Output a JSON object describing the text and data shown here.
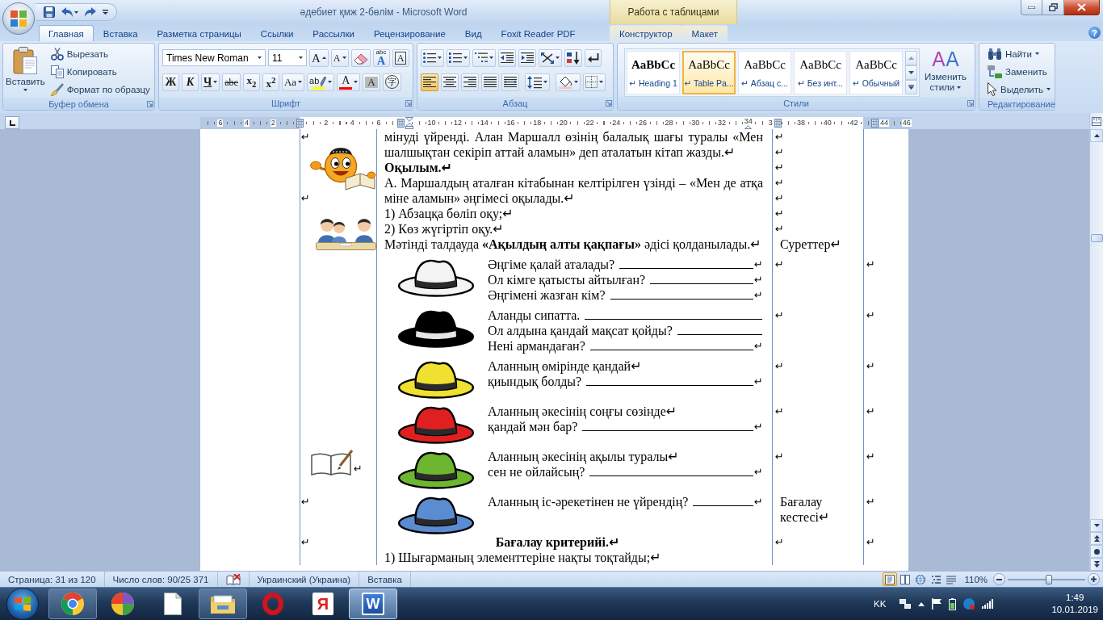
{
  "window": {
    "title": "әдебиет қмж 2-бөлім - Microsoft Word",
    "context_title": "Работа с таблицами"
  },
  "tabs": [
    {
      "label": "Главная",
      "selected": true,
      "contextual": false
    },
    {
      "label": "Вставка",
      "selected": false,
      "contextual": false
    },
    {
      "label": "Разметка страницы",
      "selected": false,
      "contextual": false
    },
    {
      "label": "Ссылки",
      "selected": false,
      "contextual": false
    },
    {
      "label": "Рассылки",
      "selected": false,
      "contextual": false
    },
    {
      "label": "Рецензирование",
      "selected": false,
      "contextual": false
    },
    {
      "label": "Вид",
      "selected": false,
      "contextual": false
    },
    {
      "label": "Foxit Reader PDF",
      "selected": false,
      "contextual": false
    },
    {
      "label": "Конструктор",
      "selected": false,
      "contextual": true
    },
    {
      "label": "Макет",
      "selected": false,
      "contextual": true
    }
  ],
  "help": "?",
  "ribbon": {
    "clipboard": {
      "title": "Буфер обмена",
      "paste": "Вставить",
      "actions": [
        "Вырезать",
        "Копировать",
        "Формат по образцу"
      ]
    },
    "font": {
      "title": "Шрифт",
      "font_name": "Times New Roman",
      "font_size": "11",
      "tools": [
        {
          "kind": "grow",
          "glyph": "A"
        },
        {
          "kind": "shrink",
          "glyph": "A"
        },
        {
          "kind": "clear"
        },
        {
          "kind": "effects",
          "glyph": "A",
          "caption": "abc"
        },
        {
          "kind": "border",
          "glyph": "A"
        }
      ],
      "format": [
        {
          "kind": "bold",
          "glyph": "Ж"
        },
        {
          "kind": "italic",
          "glyph": "К"
        },
        {
          "kind": "underline",
          "glyph": "Ч"
        },
        {
          "kind": "strike",
          "glyph": "abc"
        },
        {
          "kind": "sub",
          "glyph": "x$_{2}$"
        },
        {
          "kind": "sup",
          "glyph": "x$^{2}$"
        },
        {
          "kind": "case",
          "glyph": "Aa"
        },
        {
          "kind": "highlight",
          "glyph": "ab",
          "color": "#ffff00"
        },
        {
          "kind": "color",
          "glyph": "A",
          "color": "#ff0000"
        },
        {
          "kind": "shade",
          "glyph": "A"
        },
        {
          "kind": "enclose",
          "glyph": "字"
        }
      ]
    },
    "paragraph": {
      "title": "Абзац",
      "alignment": [
        {
          "kind": "left",
          "selected": true
        },
        {
          "kind": "center",
          "selected": false
        },
        {
          "kind": "right",
          "selected": false
        },
        {
          "kind": "justify",
          "selected": false
        },
        {
          "kind": "distribute",
          "selected": false
        }
      ]
    },
    "styles": {
      "title": "Стили",
      "items": [
        {
          "kind": "heading",
          "sample": "AaBbCc",
          "name": "↵ Heading 1",
          "selected": false
        },
        {
          "kind": "normal",
          "sample": "AaBbCc",
          "name": "↵ Table Pa...",
          "selected": true
        },
        {
          "kind": "normal",
          "sample": "AaBbCc",
          "name": "↵ Абзац с...",
          "selected": false
        },
        {
          "kind": "normal",
          "sample": "AaBbCc",
          "name": "↵ Без инт...",
          "selected": false
        },
        {
          "kind": "normal",
          "sample": "AaBbCc",
          "name": "↵ Обычный",
          "selected": false
        }
      ],
      "change": {
        "glyph": "AA",
        "label": "Изменить стили"
      }
    },
    "editing": {
      "title": "Редактирование",
      "actions": [
        {
          "label": "Найти",
          "menu": true
        },
        {
          "label": "Заменить",
          "menu": false
        },
        {
          "label": "Выделить",
          "menu": true
        }
      ]
    }
  },
  "ruler": {
    "numbers": [
      "6",
      "4",
      "2",
      "2",
      "4",
      "6",
      "10",
      "12",
      "14",
      "16",
      "18",
      "20",
      "22",
      "24",
      "26",
      "28",
      "30",
      "32",
      "34",
      "3",
      "38",
      "40",
      "42",
      "44",
      "46"
    ]
  },
  "document": {
    "rows": [
      {
        "kind": "text",
        "left": [
          {
            "kind": "mark",
            "text": "↵"
          },
          {
            "kind": "smiley"
          },
          {
            "kind": "mark",
            "text": "↵"
          },
          {
            "kind": "pupils"
          }
        ],
        "paragraphs": [
          {
            "kind": "body",
            "text": "мінуді үйренді. Алан Маршалл өзінің балалық шағы туралы «Мен шалшықтан секіріп аттай аламын» деп аталатын кітап жазды.↵"
          },
          {
            "kind": "heading",
            "text": "Оқылым.↵"
          },
          {
            "kind": "body",
            "text": "А. Маршалдың аталған кітабынан келтірілген үзінді – «Мен де атқа міне аламын» әңгімесі оқылады.↵"
          },
          {
            "kind": "body",
            "text": "1) Абзацқа бөліп оқу;↵"
          },
          {
            "kind": "body",
            "text": "2) Көз жүгіртіп оқу.↵"
          },
          {
            "kind": "body",
            "text": "Мәтінді талдауда **«Ақылдың алты қақпағы»** әдісі қолданылады.↵"
          }
        ],
        "notes": [
          {
            "kind": "mark",
            "text": "↵"
          },
          {
            "kind": "mark",
            "text": "↵"
          },
          {
            "kind": "mark",
            "text": "↵"
          },
          {
            "kind": "mark",
            "text": "↵"
          },
          {
            "kind": "mark",
            "text": "↵"
          },
          {
            "kind": "mark",
            "text": "↵"
          },
          {
            "kind": "mark",
            "text": "↵"
          },
          {
            "kind": "text",
            "text": "Суреттер↵"
          }
        ]
      },
      {
        "kind": "hat",
        "color": "#f4f4f4",
        "questions": [
          {
            "text": "Әңгіме қалай аталады?",
            "mark": "↵"
          },
          {
            "text": "Ол кімге қатысты айтылған?",
            "mark": "↵"
          },
          {
            "text": "Әңгімені жазған кім?",
            "mark": "↵"
          }
        ],
        "notes": [
          {
            "kind": "mark",
            "text": "↵"
          }
        ],
        "extra": [
          {
            "kind": "mark",
            "text": "↵"
          }
        ]
      },
      {
        "kind": "hat",
        "color": "#000000",
        "questions": [
          {
            "text": "Аланды сипатта."
          },
          {
            "text": "Ол алдына қандай мақсат қойды?"
          },
          {
            "text": "Нені армандаған?",
            "mark": "↵"
          }
        ],
        "notes": [
          {
            "kind": "mark",
            "text": "↵"
          }
        ],
        "extra": [
          {
            "kind": "mark",
            "text": "↵"
          }
        ]
      },
      {
        "kind": "hat",
        "color": "#f0e030",
        "questions": [
          {
            "lead": "Аланның өмірінде қандай↵",
            "text": "қиындық болды?",
            "mark": "↵"
          }
        ],
        "notes": [
          {
            "kind": "mark",
            "text": "↵"
          }
        ],
        "extra": [
          {
            "kind": "mark",
            "text": "↵"
          }
        ]
      },
      {
        "kind": "hat",
        "color": "#e02020",
        "questions": [
          {
            "lead": "Аланның әкесінің соңғы сөзінде↵",
            "text": "қандай мән бар?",
            "mark": "↵"
          }
        ],
        "notes": [
          {
            "kind": "mark",
            "text": "↵"
          }
        ],
        "extra": [
          {
            "kind": "mark",
            "text": "↵"
          }
        ]
      },
      {
        "kind": "hat",
        "color": "#6cb630",
        "left": [
          {
            "kind": "book",
            "text": "↵"
          }
        ],
        "questions": [
          {
            "lead": "Аланның әкесінің ақылы туралы↵",
            "text": "сен не ойлайсың?",
            "mark": "↵"
          }
        ],
        "notes": [
          {
            "kind": "mark",
            "text": "↵"
          }
        ],
        "extra": [
          {
            "kind": "mark",
            "text": "↵"
          }
        ]
      },
      {
        "kind": "hat",
        "color": "#5b8bd0",
        "left": [
          {
            "kind": "mark",
            "text": "↵"
          }
        ],
        "questions": [
          {
            "text": "Аланның іс-әрекетінен не үйрендің?",
            "mark": "↵"
          }
        ],
        "notes": [
          {
            "kind": "text",
            "text": "Бағалау кестесі↵"
          }
        ],
        "extra": [
          {
            "kind": "mark",
            "text": "↵"
          }
        ]
      },
      {
        "kind": "text",
        "left": [
          {
            "kind": "mark",
            "text": "↵"
          }
        ],
        "paragraphs": [
          {
            "kind": "title",
            "text": "Бағалау критерийі.↵"
          },
          {
            "kind": "body",
            "text": "1) Шығарманың элементтеріне нақты тоқтайды;↵"
          }
        ],
        "notes": [
          {
            "kind": "mark",
            "text": "↵"
          }
        ],
        "extra": [
          {
            "kind": "mark",
            "text": "↵"
          }
        ]
      }
    ]
  },
  "status_bar": {
    "page": "Страница: 31 из 120",
    "words": "Число слов: 90/25 371",
    "language": "Украинский (Украина)",
    "mode": "Вставка",
    "views": [
      {
        "kind": "print",
        "selected": true
      },
      {
        "kind": "reading",
        "selected": false
      },
      {
        "kind": "web",
        "selected": false
      },
      {
        "kind": "outline",
        "selected": false
      },
      {
        "kind": "draft",
        "selected": false
      }
    ],
    "zoom": "110%",
    "zoom_slider": {
      "level": 0.53
    }
  },
  "taskbar": {
    "apps": [
      {
        "kind": "tricolor",
        "running": true,
        "selected": false
      },
      {
        "kind": "ball",
        "running": false,
        "selected": false
      },
      {
        "kind": "page",
        "running": false,
        "selected": false
      },
      {
        "kind": "folder",
        "running": true,
        "selected": false
      },
      {
        "kind": "ring",
        "running": false,
        "selected": false
      },
      {
        "kind": "letter",
        "glyph": "Я",
        "running": false,
        "selected": false
      },
      {
        "kind": "document",
        "glyph": "W",
        "running": true,
        "selected": true
      }
    ],
    "language": "KK",
    "time": "1:49",
    "date": "10.01.2019"
  }
}
